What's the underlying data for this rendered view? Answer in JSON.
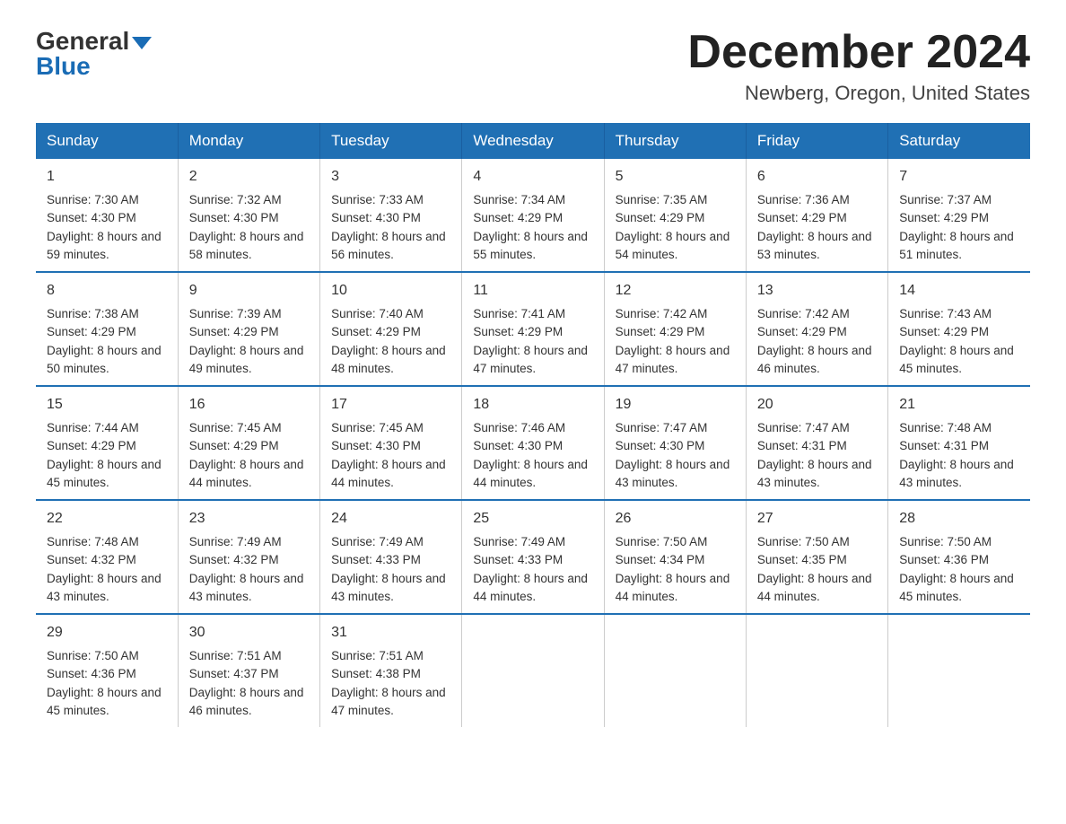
{
  "logo": {
    "line1": "General",
    "arrow": "▶",
    "line2": "Blue"
  },
  "title": "December 2024",
  "location": "Newberg, Oregon, United States",
  "days_of_week": [
    "Sunday",
    "Monday",
    "Tuesday",
    "Wednesday",
    "Thursday",
    "Friday",
    "Saturday"
  ],
  "weeks": [
    [
      {
        "day": "1",
        "sunrise": "7:30 AM",
        "sunset": "4:30 PM",
        "daylight": "8 hours and 59 minutes."
      },
      {
        "day": "2",
        "sunrise": "7:32 AM",
        "sunset": "4:30 PM",
        "daylight": "8 hours and 58 minutes."
      },
      {
        "day": "3",
        "sunrise": "7:33 AM",
        "sunset": "4:30 PM",
        "daylight": "8 hours and 56 minutes."
      },
      {
        "day": "4",
        "sunrise": "7:34 AM",
        "sunset": "4:29 PM",
        "daylight": "8 hours and 55 minutes."
      },
      {
        "day": "5",
        "sunrise": "7:35 AM",
        "sunset": "4:29 PM",
        "daylight": "8 hours and 54 minutes."
      },
      {
        "day": "6",
        "sunrise": "7:36 AM",
        "sunset": "4:29 PM",
        "daylight": "8 hours and 53 minutes."
      },
      {
        "day": "7",
        "sunrise": "7:37 AM",
        "sunset": "4:29 PM",
        "daylight": "8 hours and 51 minutes."
      }
    ],
    [
      {
        "day": "8",
        "sunrise": "7:38 AM",
        "sunset": "4:29 PM",
        "daylight": "8 hours and 50 minutes."
      },
      {
        "day": "9",
        "sunrise": "7:39 AM",
        "sunset": "4:29 PM",
        "daylight": "8 hours and 49 minutes."
      },
      {
        "day": "10",
        "sunrise": "7:40 AM",
        "sunset": "4:29 PM",
        "daylight": "8 hours and 48 minutes."
      },
      {
        "day": "11",
        "sunrise": "7:41 AM",
        "sunset": "4:29 PM",
        "daylight": "8 hours and 47 minutes."
      },
      {
        "day": "12",
        "sunrise": "7:42 AM",
        "sunset": "4:29 PM",
        "daylight": "8 hours and 47 minutes."
      },
      {
        "day": "13",
        "sunrise": "7:42 AM",
        "sunset": "4:29 PM",
        "daylight": "8 hours and 46 minutes."
      },
      {
        "day": "14",
        "sunrise": "7:43 AM",
        "sunset": "4:29 PM",
        "daylight": "8 hours and 45 minutes."
      }
    ],
    [
      {
        "day": "15",
        "sunrise": "7:44 AM",
        "sunset": "4:29 PM",
        "daylight": "8 hours and 45 minutes."
      },
      {
        "day": "16",
        "sunrise": "7:45 AM",
        "sunset": "4:29 PM",
        "daylight": "8 hours and 44 minutes."
      },
      {
        "day": "17",
        "sunrise": "7:45 AM",
        "sunset": "4:30 PM",
        "daylight": "8 hours and 44 minutes."
      },
      {
        "day": "18",
        "sunrise": "7:46 AM",
        "sunset": "4:30 PM",
        "daylight": "8 hours and 44 minutes."
      },
      {
        "day": "19",
        "sunrise": "7:47 AM",
        "sunset": "4:30 PM",
        "daylight": "8 hours and 43 minutes."
      },
      {
        "day": "20",
        "sunrise": "7:47 AM",
        "sunset": "4:31 PM",
        "daylight": "8 hours and 43 minutes."
      },
      {
        "day": "21",
        "sunrise": "7:48 AM",
        "sunset": "4:31 PM",
        "daylight": "8 hours and 43 minutes."
      }
    ],
    [
      {
        "day": "22",
        "sunrise": "7:48 AM",
        "sunset": "4:32 PM",
        "daylight": "8 hours and 43 minutes."
      },
      {
        "day": "23",
        "sunrise": "7:49 AM",
        "sunset": "4:32 PM",
        "daylight": "8 hours and 43 minutes."
      },
      {
        "day": "24",
        "sunrise": "7:49 AM",
        "sunset": "4:33 PM",
        "daylight": "8 hours and 43 minutes."
      },
      {
        "day": "25",
        "sunrise": "7:49 AM",
        "sunset": "4:33 PM",
        "daylight": "8 hours and 44 minutes."
      },
      {
        "day": "26",
        "sunrise": "7:50 AM",
        "sunset": "4:34 PM",
        "daylight": "8 hours and 44 minutes."
      },
      {
        "day": "27",
        "sunrise": "7:50 AM",
        "sunset": "4:35 PM",
        "daylight": "8 hours and 44 minutes."
      },
      {
        "day": "28",
        "sunrise": "7:50 AM",
        "sunset": "4:36 PM",
        "daylight": "8 hours and 45 minutes."
      }
    ],
    [
      {
        "day": "29",
        "sunrise": "7:50 AM",
        "sunset": "4:36 PM",
        "daylight": "8 hours and 45 minutes."
      },
      {
        "day": "30",
        "sunrise": "7:51 AM",
        "sunset": "4:37 PM",
        "daylight": "8 hours and 46 minutes."
      },
      {
        "day": "31",
        "sunrise": "7:51 AM",
        "sunset": "4:38 PM",
        "daylight": "8 hours and 47 minutes."
      },
      null,
      null,
      null,
      null
    ]
  ],
  "labels": {
    "sunrise": "Sunrise:",
    "sunset": "Sunset:",
    "daylight": "Daylight:"
  }
}
